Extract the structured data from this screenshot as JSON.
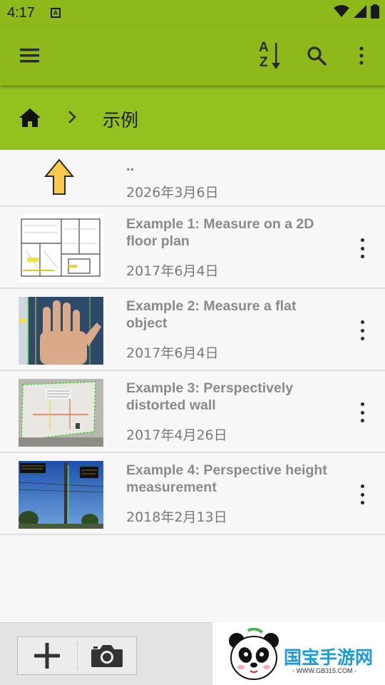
{
  "status_bar": {
    "time": "4:17",
    "notification_letter": "A"
  },
  "toolbar": {
    "menu_icon": "menu-icon",
    "sort_icon": "sort-alpha-icon",
    "sort_letter_top": "A",
    "sort_letter_bottom": "Z",
    "search_icon": "search-icon",
    "more_icon": "more-vert-icon"
  },
  "breadcrumb": {
    "home_icon": "home-icon",
    "separator_icon": "chevron-right-icon",
    "current": "示例"
  },
  "parent_entry": {
    "name": "..",
    "date": "2026年3月6日",
    "icon": "up-arrow-icon"
  },
  "files": [
    {
      "title": "Example 1: Measure on a 2D floor plan",
      "date": "2017年6月4日"
    },
    {
      "title": "Example 2: Measure a flat object",
      "date": "2017年6月4日"
    },
    {
      "title": "Example 3: Perspectively distorted wall",
      "date": "2017年4月26日"
    },
    {
      "title": "Example 4: Perspective height measurement",
      "date": "2018年2月13日"
    }
  ],
  "bottom_bar": {
    "add_icon": "plus-icon",
    "camera_icon": "camera-icon"
  },
  "watermark": {
    "text": "国宝手游网",
    "url": "- WWW.GB315.COM -"
  },
  "colors": {
    "app_bar": "#8fb91a",
    "breadcrumb": "#95c11f",
    "up_arrow": "#fbc94d"
  }
}
